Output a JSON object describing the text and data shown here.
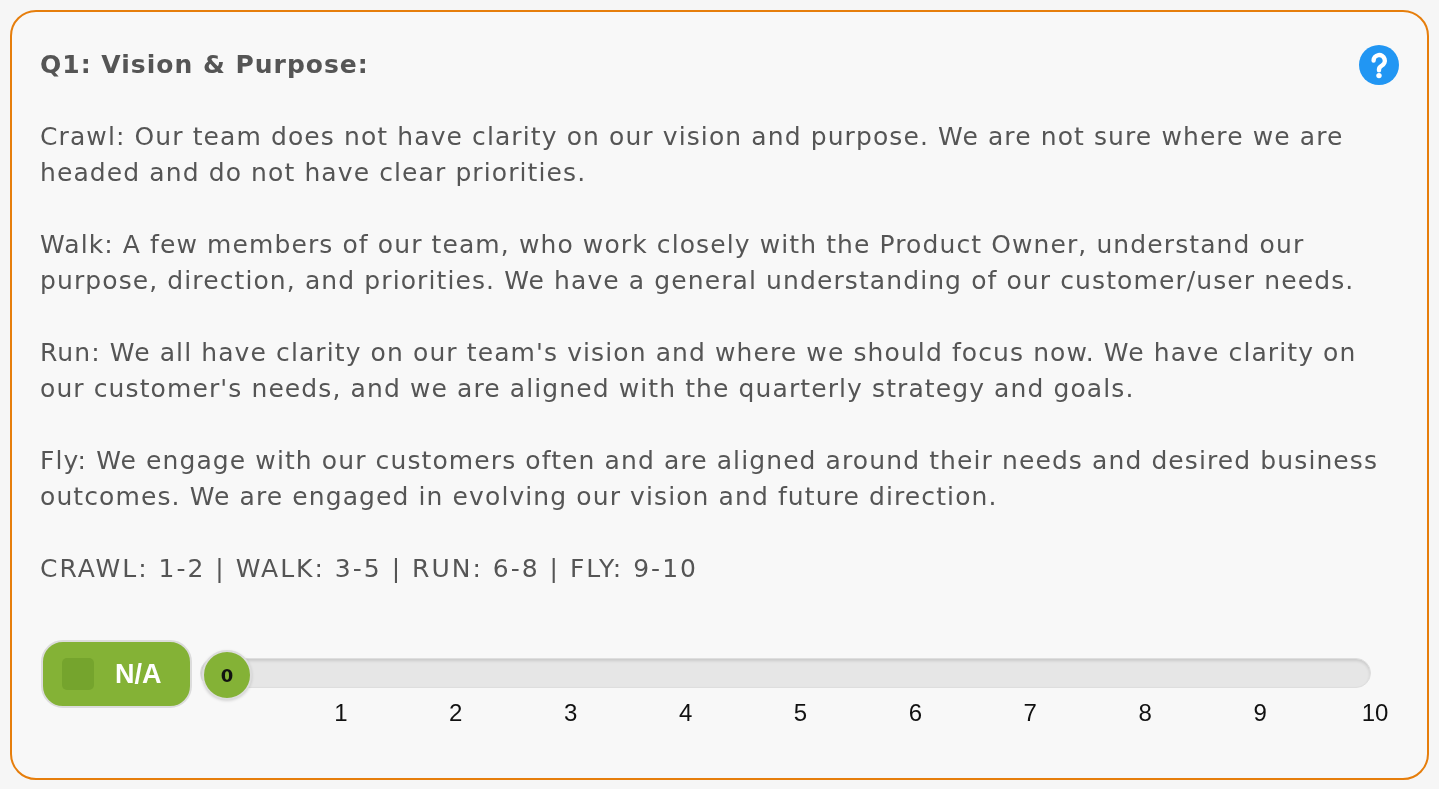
{
  "question": {
    "title": "Q1: Vision & Purpose:",
    "descriptions": [
      "Crawl: Our team does not have clarity on our vision and purpose. We are not sure where we are headed and do not have clear priorities.",
      "Walk: A few members of our team, who work closely with the Product Owner, understand our purpose, direction, and priorities. We have a general understanding of our customer/user needs.",
      "Run: We all have clarity on our team's vision and where we should focus now. We have clarity on our customer's needs, and we are aligned with the quarterly strategy and goals.",
      "Fly: We engage with our customers often and are aligned around their needs and desired business outcomes. We are engaged in evolving our vision and future direction."
    ],
    "scale_legend": "CRAWL: 1-2 | WALK: 3-5 | RUN: 6-8 | FLY: 9-10"
  },
  "na_toggle": {
    "label": "N/A",
    "checked": false
  },
  "slider": {
    "value": "0",
    "level": 0,
    "ticks": [
      "1",
      "2",
      "3",
      "4",
      "5",
      "6",
      "7",
      "8",
      "9",
      "10"
    ]
  }
}
